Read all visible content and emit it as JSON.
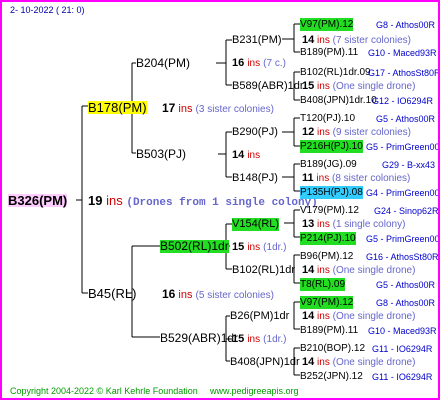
{
  "header_date": "2- 10-2022 ( 21: 0)",
  "root": {
    "id": "B326(PM)",
    "ins": "19",
    "ins_word": "ins",
    "note": "(Drones from 1 single colony)"
  },
  "mother": {
    "id": "B178(PM)",
    "ins": "17",
    "ins_word": "ins",
    "note": "(3 sister colonies)"
  },
  "father": {
    "id": "B45(RL)"
  },
  "B204": {
    "id": "B204(PM)",
    "ins": "16",
    "ins_word": "ins",
    "note": "(7 c.)"
  },
  "B503": {
    "id": "B503(PJ)",
    "ins": "14",
    "ins_word": "ins"
  },
  "B502": {
    "id": "B502(RL)1dr",
    "ins": "15",
    "ins_word": "ins",
    "note": "(1dr.)"
  },
  "B529": {
    "id": "B529(ABR)1dr",
    "ins": "15",
    "ins_word": "ins",
    "note": "(1dr.)"
  },
  "father_sub": {
    "ins": "16",
    "ins_word": "ins",
    "note": "(5 sister colonies)"
  },
  "B231": {
    "id": "B231(PM)",
    "ins": "14",
    "ins_word": "ins",
    "note": "(7 sister colonies)"
  },
  "B589": {
    "id": "B589(ABR)1dr",
    "ins": "15",
    "ins_word": "ins",
    "note": "(One single drone)"
  },
  "B290": {
    "id": "B290(PJ)",
    "ins": "12",
    "ins_word": "ins",
    "note": "(9 sister colonies)"
  },
  "B148": {
    "id": "B148(PJ)",
    "ins": "11",
    "ins_word": "ins",
    "note": "(8 sister colonies)"
  },
  "V154": {
    "id": "V154(RL)",
    "ins": "13",
    "ins_word": "ins",
    "note": "(1 single colony)"
  },
  "B102": {
    "id": "B102(RL)1dr",
    "ins": "14",
    "ins_word": "ins",
    "note": "(One single drone)"
  },
  "B26": {
    "id": "B26(PM)1dr",
    "ins": "14",
    "ins_word": "ins",
    "note": "(One single drone)"
  },
  "B408": {
    "id": "B408(JPN)1dr",
    "ins": "14",
    "ins_word": "ins",
    "note": "(One single drone)"
  },
  "leaves": [
    {
      "id": "V97(PM).12",
      "info": "G8 - Athos00R"
    },
    {
      "id": "B189(PM).11",
      "info": "G10 - Maced93R"
    },
    {
      "id": "B102(RL)1dr.09",
      "info": "G17 - AthosSt80R"
    },
    {
      "id": "B408(JPN)1dr.10",
      "info": "G12 - IO6294R"
    },
    {
      "id": "T120(PJ).10",
      "info": "G5 - Athos00R"
    },
    {
      "id": "P216H(PJ).10",
      "info": "G5 - PrimGreen00"
    },
    {
      "id": "B189(JG).09",
      "info": "G29 - B-xx43"
    },
    {
      "id": "P135H(PJ).08",
      "info": "G4 - PrimGreen00"
    },
    {
      "id": "V179(PM).12",
      "info": "G24 - Sinop62R"
    },
    {
      "id": "P214(PJ).10",
      "info": "G5 - PrimGreen00"
    },
    {
      "id": "B96(PM).12",
      "info": "G16 - AthosSt80R"
    },
    {
      "id": "T8(RL).09",
      "info": "G5 - Athos00R"
    },
    {
      "id": "V97(PM).12",
      "info": "G8 - Athos00R"
    },
    {
      "id": "B189(PM).11",
      "info": "G10 - Maced93R"
    },
    {
      "id": "B210(BOP).12",
      "info": "G11 - IO6294R"
    },
    {
      "id": "B252(JPN).12",
      "info": "G11 - IO6294R"
    }
  ],
  "footer": {
    "copyright": "Copyright 2004-2022 © Karl Kehrle Foundation",
    "site": "www.pedigreeapis.org"
  },
  "colors": {
    "border": "#ff00ff",
    "ins_red": "#cc0000",
    "note_purple": "#6666cc",
    "info_blue": "#0000cc",
    "footer_green": "#009900",
    "hl_pink": "#ffccff",
    "hl_yellow": "#ffff00",
    "hl_green": "#22dd22",
    "hl_cyan": "#33ccff"
  }
}
